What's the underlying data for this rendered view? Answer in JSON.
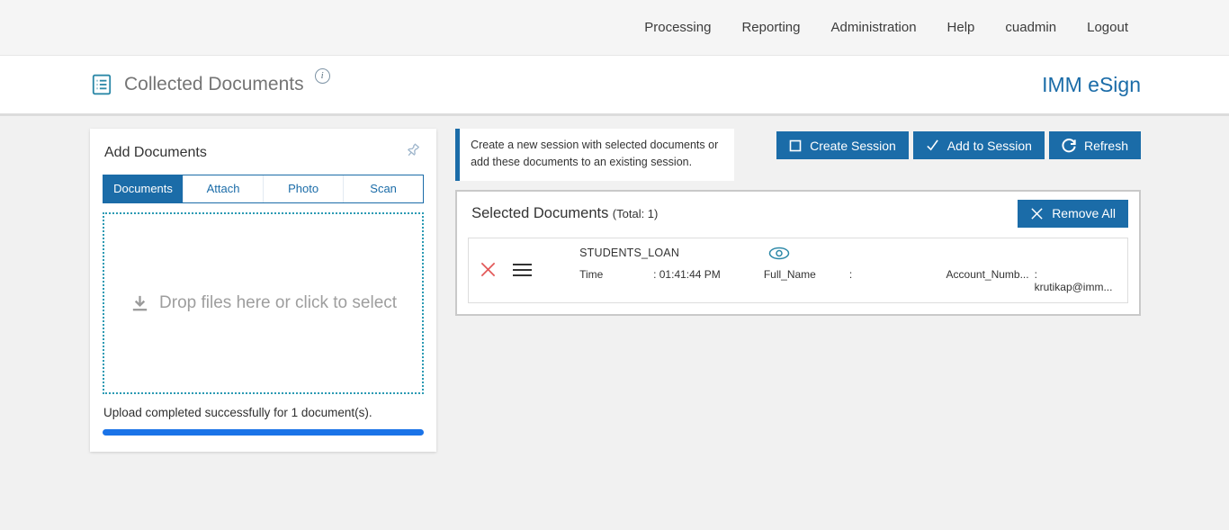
{
  "colors": {
    "accent": "#1b6ca8",
    "progress_blue": "#1a73e8",
    "danger_red": "#e25757",
    "dropzone_teal": "#2b9ab3"
  },
  "icons": {
    "collected-documents-icon": "document-list",
    "info-icon": "i",
    "pin-icon": "pushpin",
    "download-icon": "download-arrow",
    "create-session-icon": "square",
    "add-to-session-icon": "check",
    "refresh-icon": "refresh-arrow",
    "remove-all-icon": "x",
    "delete-row-icon": "x",
    "drag-handle-icon": "hamburger",
    "preview-icon": "eye"
  },
  "topnav": {
    "items": [
      "Processing",
      "Reporting",
      "Administration",
      "Help",
      "cuadmin",
      "Logout"
    ]
  },
  "header": {
    "title": "Collected Documents",
    "brand": "IMM eSign"
  },
  "add_documents": {
    "title": "Add Documents",
    "tabs": [
      "Documents",
      "Attach",
      "Photo",
      "Scan"
    ],
    "active_tab": "Documents",
    "dropzone_text": "Drop files here or click to select",
    "status_text": "Upload completed successfully for 1 document(s)."
  },
  "session_actions": {
    "info_text": "Create a new session with selected documents or add these documents to an existing session.",
    "create_session_label": "Create Session",
    "add_to_session_label": "Add to Session",
    "refresh_label": "Refresh"
  },
  "selected_documents": {
    "title": "Selected Documents",
    "total_label": "(Total: 1)",
    "remove_all_label": "Remove All",
    "rows": [
      {
        "name": "STUDENTS_LOAN",
        "fields": [
          {
            "label": "Time",
            "value": ": 01:41:44 PM"
          },
          {
            "label": "Full_Name",
            "value": ":"
          },
          {
            "label": "Account_Numb...",
            "value": ": krutikap@imm..."
          }
        ]
      }
    ]
  }
}
